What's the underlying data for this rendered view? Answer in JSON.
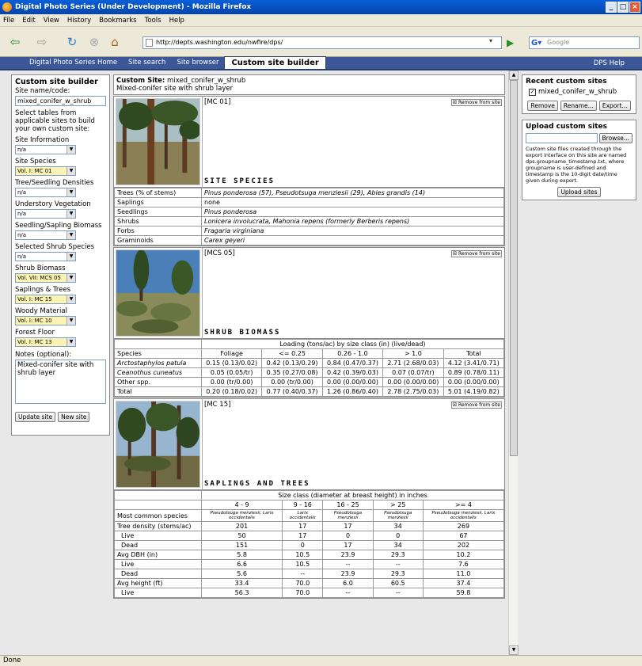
{
  "window": {
    "title": "Digital Photo Series (Under Development) - Mozilla Firefox",
    "minimize": "_",
    "maximize": "□",
    "close": "×"
  },
  "menu": [
    "File",
    "Edit",
    "View",
    "History",
    "Bookmarks",
    "Tools",
    "Help"
  ],
  "navbar": {
    "url": "http://depts.washington.edu/nwfire/dps/",
    "search_placeholder": "Google",
    "back_icon": "back-arrow-icon",
    "forward_icon": "forward-arrow-icon",
    "reload_icon": "reload-icon",
    "stop_icon": "stop-icon",
    "home_icon": "home-icon"
  },
  "tabs": [
    "Digital Photo Series Home",
    "Site search",
    "Site browser",
    "Custom site builder"
  ],
  "help_label": "DPS Help",
  "left": {
    "title": "Custom site builder",
    "name_label": "Site name/code:",
    "name_value": "mixed_conifer_w_shrub",
    "hint": "Select tables from applicable sites to build your own custom site:",
    "fields": [
      {
        "label": "Site Information",
        "value": "n/a",
        "highlight": false
      },
      {
        "label": "Site Species",
        "value": "Vol. I: MC 01",
        "highlight": true
      },
      {
        "label": "Tree/Seedling Densities",
        "value": "n/a",
        "highlight": false
      },
      {
        "label": "Understory Vegetation",
        "value": "n/a",
        "highlight": false
      },
      {
        "label": "Seedling/Sapling Biomass",
        "value": "n/a",
        "highlight": false
      },
      {
        "label": "Selected Shrub Species",
        "value": "n/a",
        "highlight": false
      },
      {
        "label": "Shrub Biomass",
        "value": "Vol. VII: MCS 05",
        "highlight": true
      },
      {
        "label": "Saplings & Trees",
        "value": "Vol. I: MC 15",
        "highlight": true
      },
      {
        "label": "Woody Material",
        "value": "Vol. I: MC 10",
        "highlight": true
      },
      {
        "label": "Forest Floor",
        "value": "Vol. I: MC 13",
        "highlight": true
      }
    ],
    "notes_label": "Notes (optional):",
    "notes_value": "Mixed-conifer site with shrub layer",
    "update_btn": "Update site",
    "new_btn": "New site"
  },
  "site": {
    "label": "Custom Site:",
    "code": "mixed_conifer_w_shrub",
    "desc": "Mixed-conifer site with shrub layer"
  },
  "remove_label": "Remove from site",
  "species_card": {
    "code": "[MC 01]",
    "title": "SITE SPECIES",
    "rows": [
      [
        "Trees (% of stems)",
        "Pinus ponderosa (57), Pseudotsuga menziesii (29), Abies grandis (14)"
      ],
      [
        "Saplings",
        "none"
      ],
      [
        "Seedlings",
        "Pinus ponderosa"
      ],
      [
        "Shrubs",
        "Lonicera involucrata, Mahonia repens (formerly Berberis repens)"
      ],
      [
        "Forbs",
        "Fragaria virginiana"
      ],
      [
        "Graminoids",
        "Carex geyeri"
      ]
    ]
  },
  "shrub_card": {
    "code": "[MCS 05]",
    "title": "SHRUB BIOMASS",
    "span_header": "Loading (tons/ac) by size class (in) (live/dead)",
    "columns": [
      "Species",
      "Foliage",
      "<= 0.25",
      "0.26 - 1.0",
      "> 1.0",
      "Total"
    ],
    "rows": [
      [
        "Arctostaphylos patula",
        "0.15 (0.13/0.02)",
        "0.42 (0.13/0.29)",
        "0.84 (0.47/0.37)",
        "2.71 (2.68/0.03)",
        "4.12 (3.41/0.71)"
      ],
      [
        "Ceanothus cuneatus",
        "0.05 (0.05/tr)",
        "0.35 (0.27/0.08)",
        "0.42 (0.39/0.03)",
        "0.07 (0.07/tr)",
        "0.89 (0.78/0.11)"
      ],
      [
        "Other spp.",
        "0.00 (tr/0.00)",
        "0.00 (tr/0.00)",
        "0.00 (0.00/0.00)",
        "0.00 (0.00/0.00)",
        "0.00 (0.00/0.00)"
      ],
      [
        "Total",
        "0.20 (0.18/0.02)",
        "0.77 (0.40/0.37)",
        "1.26 (0.86/0.40)",
        "2.78 (2.75/0.03)",
        "5.01 (4.19/0.82)"
      ]
    ]
  },
  "trees_card": {
    "code": "[MC 15]",
    "title": "SAPLINGS AND TREES",
    "span_header": "Size class (diameter at breast height) in inches",
    "columns": [
      "4 - 9",
      "9 - 16",
      "16 - 25",
      "> 25",
      ">= 4"
    ],
    "species_label": "Most common species",
    "species": [
      "Pseudotsuga menziesii, Larix occidentalis",
      "Larix occidentalis",
      "Pseudotsuga menziesii",
      "Pseudotsuga menziesii",
      "Pseudotsuga menziesii, Larix occidentalis"
    ],
    "rows": [
      {
        "label": "Tree density (stems/ac)",
        "indent": false,
        "values": [
          "201",
          "17",
          "17",
          "34",
          "269"
        ]
      },
      {
        "label": "Live",
        "indent": true,
        "values": [
          "50",
          "17",
          "0",
          "0",
          "67"
        ]
      },
      {
        "label": "Dead",
        "indent": true,
        "values": [
          "151",
          "0",
          "17",
          "34",
          "202"
        ]
      },
      {
        "label": "Avg DBH (in)",
        "indent": false,
        "values": [
          "5.8",
          "10.5",
          "23.9",
          "29.3",
          "10.2"
        ]
      },
      {
        "label": "Live",
        "indent": true,
        "values": [
          "6.6",
          "10.5",
          "--",
          "--",
          "7.6"
        ]
      },
      {
        "label": "Dead",
        "indent": true,
        "values": [
          "5.6",
          "--",
          "23.9",
          "29.3",
          "11.0"
        ]
      },
      {
        "label": "Avg height (ft)",
        "indent": false,
        "values": [
          "33.4",
          "70.0",
          "6.0",
          "60.5",
          "37.4"
        ]
      },
      {
        "label": "Live",
        "indent": true,
        "values": [
          "56.3",
          "70.0",
          "--",
          "--",
          "59.8"
        ]
      }
    ]
  },
  "right": {
    "recent_title": "Recent custom sites",
    "recent_item": "mixed_conifer_w_shrub",
    "btns": [
      "Remove",
      "Rename...",
      "Export..."
    ],
    "upload_title": "Upload custom sites",
    "browse_label": "Browse...",
    "upload_desc": "Custom site files created through the export interface on this site are named dps.groupname_timestamp.txt, where groupname is user-defined and timestamp is the 10-digit date/time given during export.",
    "upload_btn": "Upload sites"
  },
  "status": "Done"
}
